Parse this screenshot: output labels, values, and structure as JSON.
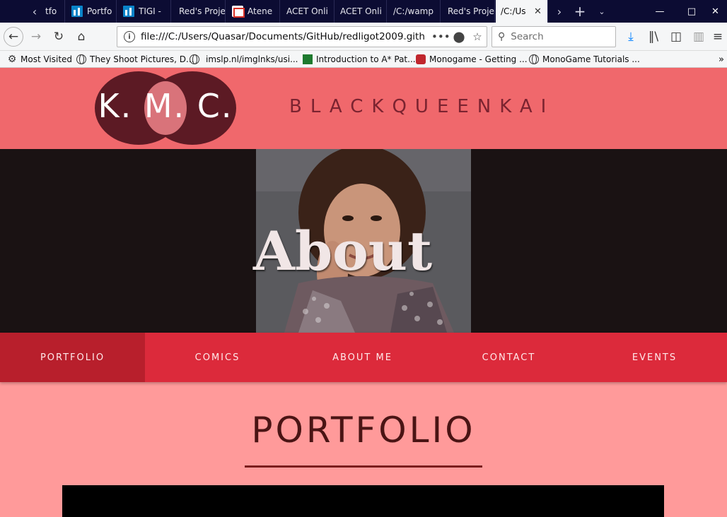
{
  "browser": {
    "tabs": [
      {
        "label": "tfo",
        "icon": "none"
      },
      {
        "label": "Portfo",
        "icon": "chart-icon"
      },
      {
        "label": "TIGI -",
        "icon": "chart-icon"
      },
      {
        "label": "Red's Proje",
        "icon": "none"
      },
      {
        "label": "Atene",
        "icon": "gmail-icon"
      },
      {
        "label": "ACET Onli",
        "icon": "none"
      },
      {
        "label": "ACET Onli",
        "icon": "none"
      },
      {
        "label": "/C:/wamp",
        "icon": "none"
      },
      {
        "label": "Red's Proje",
        "icon": "none"
      },
      {
        "label": "/C:/Us",
        "icon": "none",
        "active": true
      }
    ],
    "url": "file:///C:/Users/Quasar/Documents/GitHub/redligot2009.gith",
    "search_placeholder": "Search",
    "bookmarks": [
      {
        "label": "Most Visited",
        "icon": "gear-icon"
      },
      {
        "label": "They Shoot Pictures, D...",
        "icon": "globe-icon"
      },
      {
        "label": "imslp.nl/imglnks/usi...",
        "icon": "globe-icon"
      },
      {
        "label": "Introduction to A* Pat...",
        "icon": "astar-icon"
      },
      {
        "label": "Monogame - Getting ...",
        "icon": "monogame-icon"
      },
      {
        "label": "MonoGame Tutorials ...",
        "icon": "globe-icon"
      }
    ]
  },
  "site": {
    "logo_text": "K. M. C.",
    "name": "BLACKQUEENKAI",
    "hero_title": "About",
    "nav": [
      "PORTFOLIO",
      "COMICS",
      "ABOUT ME",
      "CONTACT",
      "EVENTS"
    ],
    "active_nav": "PORTFOLIO",
    "section_title": "PORTFOLIO"
  },
  "colors": {
    "header_bg": "#f0686c",
    "nav_bg": "#dc2a3b",
    "nav_active": "#b81f2c",
    "page_bg": "#ff9a9a",
    "hero_bg": "#1a1213"
  }
}
